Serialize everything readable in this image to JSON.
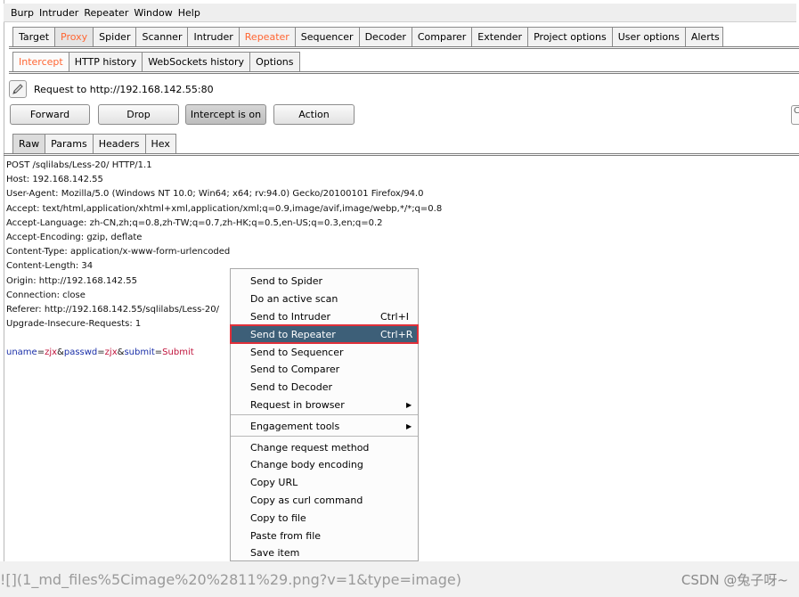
{
  "menubar": {
    "items": [
      "Burp",
      "Intruder",
      "Repeater",
      "Window",
      "Help"
    ]
  },
  "main_tabs": [
    "Target",
    "Proxy",
    "Spider",
    "Scanner",
    "Intruder",
    "Repeater",
    "Sequencer",
    "Decoder",
    "Comparer",
    "Extender",
    "Project options",
    "User options",
    "Alerts"
  ],
  "proxy_tabs": [
    "Intercept",
    "HTTP history",
    "WebSockets history",
    "Options"
  ],
  "intercept": {
    "request_label": "Request to http://192.168.142.55:80",
    "buttons": {
      "forward": "Forward",
      "drop": "Drop",
      "intercept": "Intercept is on",
      "action": "Action"
    }
  },
  "message_tabs": [
    "Raw",
    "Params",
    "Headers",
    "Hex"
  ],
  "request": {
    "lines": [
      "POST /sqlilabs/Less-20/ HTTP/1.1",
      "Host: 192.168.142.55",
      "User-Agent: Mozilla/5.0 (Windows NT 10.0; Win64; x64; rv:94.0) Gecko/20100101 Firefox/94.0",
      "Accept: text/html,application/xhtml+xml,application/xml;q=0.9,image/avif,image/webp,*/*;q=0.8",
      "Accept-Language: zh-CN,zh;q=0.8,zh-TW;q=0.7,zh-HK;q=0.5,en-US;q=0.3,en;q=0.2",
      "Accept-Encoding: gzip, deflate",
      "Content-Type: application/x-www-form-urlencoded",
      "Content-Length: 34",
      "Origin: http://192.168.142.55",
      "Connection: close",
      "Referer: http://192.168.142.55/sqlilabs/Less-20/",
      "Upgrade-Insecure-Requests: 1"
    ],
    "body": {
      "p1": "uname",
      "eq1": "=",
      "v1": "zjx",
      "amp1": "&",
      "p2": "passwd",
      "eq2": "=",
      "v2": "zjx",
      "amp2": "&",
      "p3": "submit",
      "eq3": "=",
      "v3": "Submit"
    }
  },
  "context_menu": {
    "group1": [
      {
        "label": "Send to Spider",
        "shortcut": ""
      },
      {
        "label": "Do an active scan",
        "shortcut": ""
      },
      {
        "label": "Send to Intruder",
        "shortcut": "Ctrl+I"
      },
      {
        "label": "Send to Repeater",
        "shortcut": "Ctrl+R"
      },
      {
        "label": "Send to Sequencer",
        "shortcut": ""
      },
      {
        "label": "Send to Comparer",
        "shortcut": ""
      },
      {
        "label": "Send to Decoder",
        "shortcut": ""
      },
      {
        "label": "Request in browser",
        "shortcut": ""
      }
    ],
    "group2": [
      {
        "label": "Engagement tools"
      }
    ],
    "group3": [
      {
        "label": "Change request method"
      },
      {
        "label": "Change body encoding"
      },
      {
        "label": "Copy URL"
      },
      {
        "label": "Copy as curl command"
      },
      {
        "label": "Copy to file"
      },
      {
        "label": "Paste from file"
      },
      {
        "label": "Save item"
      }
    ]
  },
  "footer": {
    "image_link": "![](1_md_files%5Cimage%20%2811%29.png?v=1&type=image)",
    "credit": "CSDN @兔子呀~"
  },
  "colors": {
    "active_tab": "#ff6633",
    "menu_highlight": "#3d5f78",
    "highlight_border": "#e0303a",
    "param_name": "#1a2fa8",
    "param_value": "#c0143c"
  }
}
